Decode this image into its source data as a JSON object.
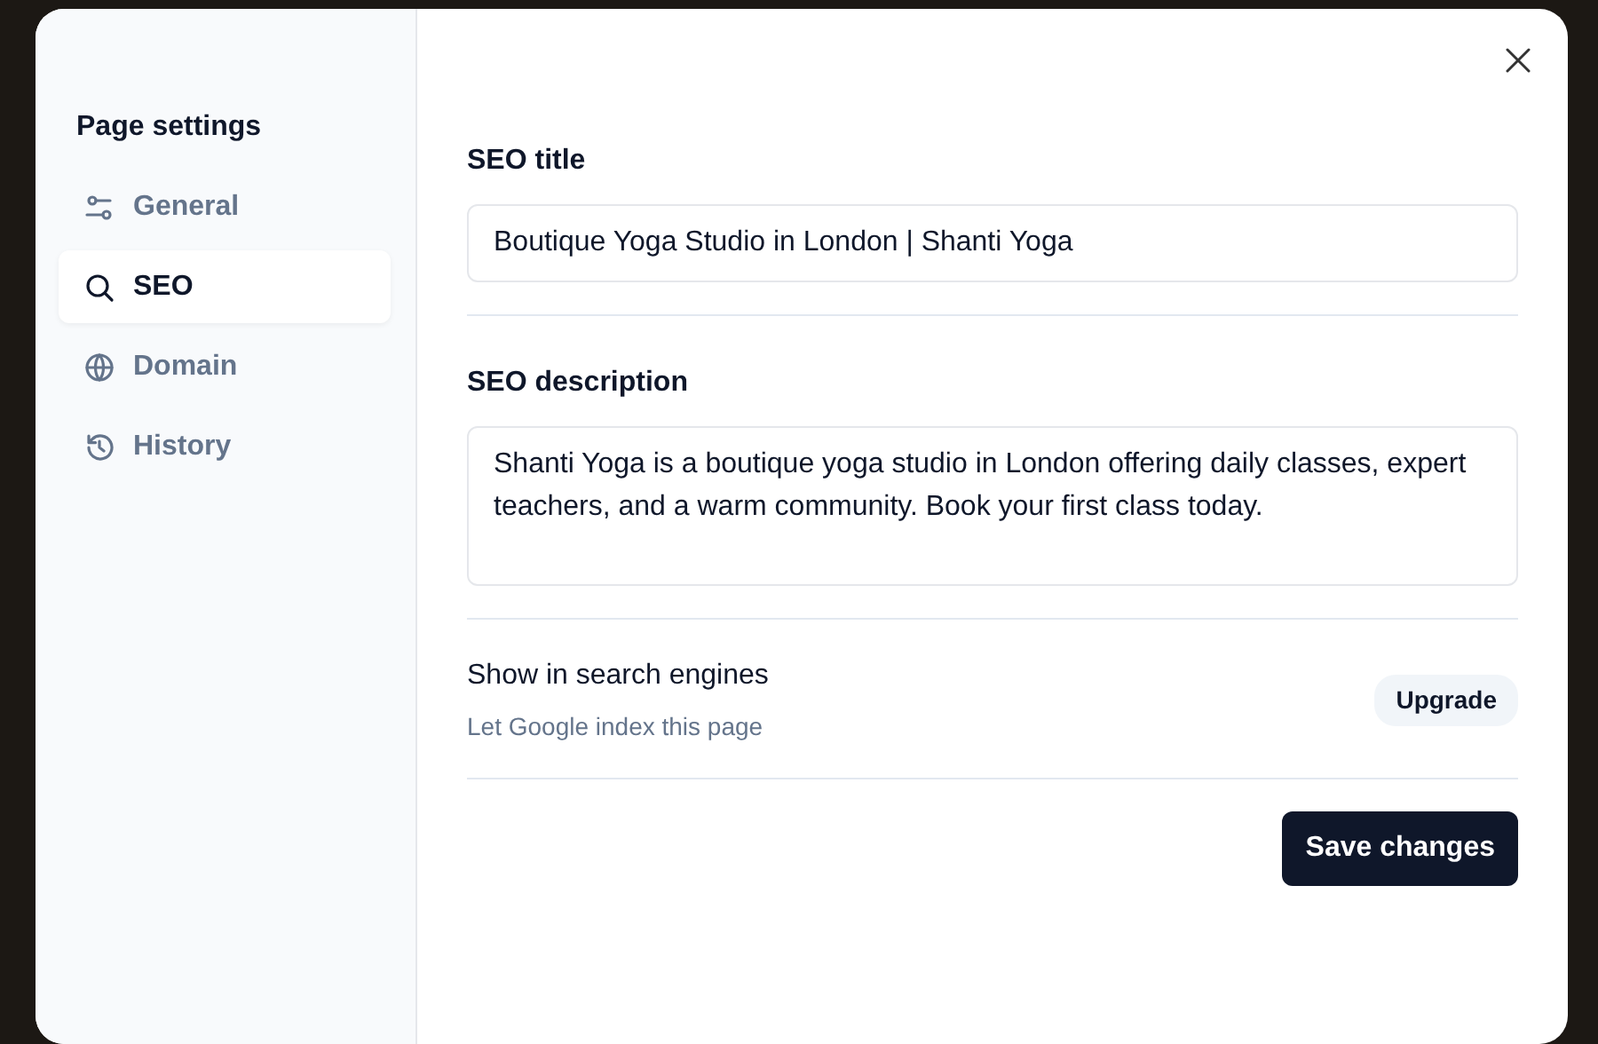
{
  "sidebar": {
    "title": "Page settings",
    "items": [
      {
        "label": "General",
        "kind": "sliders",
        "selected": false
      },
      {
        "label": "SEO",
        "kind": "search",
        "selected": true
      },
      {
        "label": "Domain",
        "kind": "globe",
        "selected": false
      },
      {
        "label": "History",
        "kind": "history",
        "selected": false
      }
    ]
  },
  "seo_title": {
    "label": "SEO title",
    "value": "Boutique Yoga Studio in London | Shanti Yoga"
  },
  "seo_description": {
    "label": "SEO description",
    "value": "Shanti Yoga is a boutique yoga studio in London offering daily classes, expert teachers, and a warm community. Book your first class today."
  },
  "search_engines": {
    "title": "Show in search engines",
    "description": "Let Google index this page",
    "button": "Upgrade"
  },
  "save_button": "Save changes"
}
